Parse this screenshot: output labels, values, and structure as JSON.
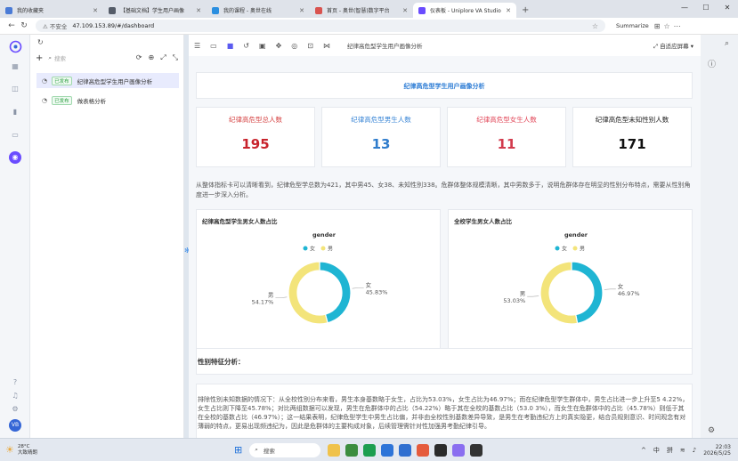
{
  "browser": {
    "tabs": [
      {
        "title": "我的收藏夹",
        "color": "#4a7bd6"
      },
      {
        "title": "【基础文档】学生用户画像",
        "color": "#555c68"
      },
      {
        "title": "我的课程 - 奥世在线",
        "color": "#2b8fe0"
      },
      {
        "title": "首页 - 奥世(智慧)数字平台",
        "color": "#d9534f"
      },
      {
        "title": "仪表板 - Uniplore VA Studio",
        "color": "#6a4cff"
      }
    ],
    "new_tab": "+",
    "security_label": "不安全",
    "url": "47.109.153.89/#/dashboard",
    "summarize": "Summarize"
  },
  "tree": {
    "search_placeholder": "搜索",
    "items": [
      {
        "status": "已发布",
        "label": "纪律高危型学生用户画像分析",
        "selected": true
      },
      {
        "status": "已发布",
        "label": "做表格分析",
        "selected": false
      }
    ]
  },
  "rail": {
    "avatar": "VB"
  },
  "main": {
    "dashboard_name": "纪律高危型学生用户画像分析",
    "adaptive_label": "自适应屏幕",
    "page_title": "纪律高危型学生用户画像分析",
    "kpis": [
      {
        "label": "纪律高危型总人数",
        "value": "195",
        "label_color": "#d64545",
        "value_color": "#c8232c"
      },
      {
        "label": "纪律高危型男生人数",
        "value": "13",
        "label_color": "#3a86d6",
        "value_color": "#2f7ccc"
      },
      {
        "label": "纪律高危型女生人数",
        "value": "11",
        "label_color": "#e2485a",
        "value_color": "#d23a4c"
      },
      {
        "label": "纪律高危型未知性别人数",
        "value": "171",
        "label_color": "#222222",
        "value_color": "#111111"
      }
    ],
    "summary": "从整体指标卡可以清晰看到，纪律危型学总数为421，其中男45、女38、未知性别338。危群体整体规模清晰，其中男数多于，说明危群体存在明显的性别分布特点，需要从性别角度进一步深入分析。",
    "features_title": "性别特征分析：",
    "features_text": "排除性别未知数据的情况下：从全校性别分布来看，男生本身基数略于女生，占比为53.03%，女生占比为46.97%；而在纪律危型学生群体中，男生占比进一步上升至5 4.22%，女生占比则下降至45.78%；对比两组数据可以发现，男生在危群体中的占比（54.22%）略于其在全校的基数占比（53.0 3%），而女生在危群体中的占比（45.78%）则低于其在全校的基数占比（46.97%）；这一结果表明，纪律危型学生中男生占比偏，并非由全校性别基数差异导致，是男生在考勤违纪方上的真实隐更，结合员规则意识、时间观念有对薄弱的特点，更易出现频违纪为，因此是危群体的主要构成对象，后续管理需针对性加强男考勤纪律引导。"
  },
  "chart_data": [
    {
      "type": "pie",
      "title": "纪律高危型学生男女人数占比",
      "legend_title": "gender",
      "legend_position": "top",
      "categories": [
        "女",
        "男"
      ],
      "values": [
        45.83,
        54.17
      ],
      "labels": [
        "45.83%",
        "54.17%"
      ],
      "colors": [
        "#1fb5d3",
        "#f3e47a"
      ]
    },
    {
      "type": "pie",
      "title": "全校学生男女人数占比",
      "legend_title": "gender",
      "legend_position": "top",
      "categories": [
        "女",
        "男"
      ],
      "values": [
        46.97,
        53.03
      ],
      "labels": [
        "46.97%",
        "53.03%"
      ],
      "colors": [
        "#1fb5d3",
        "#f3e47a"
      ]
    }
  ],
  "taskbar": {
    "temp": "28°C",
    "weather": "大致晴朗",
    "search": "搜索",
    "ime": "中",
    "ime2": "拼",
    "time": "22:03",
    "date": "2026/5/25"
  }
}
